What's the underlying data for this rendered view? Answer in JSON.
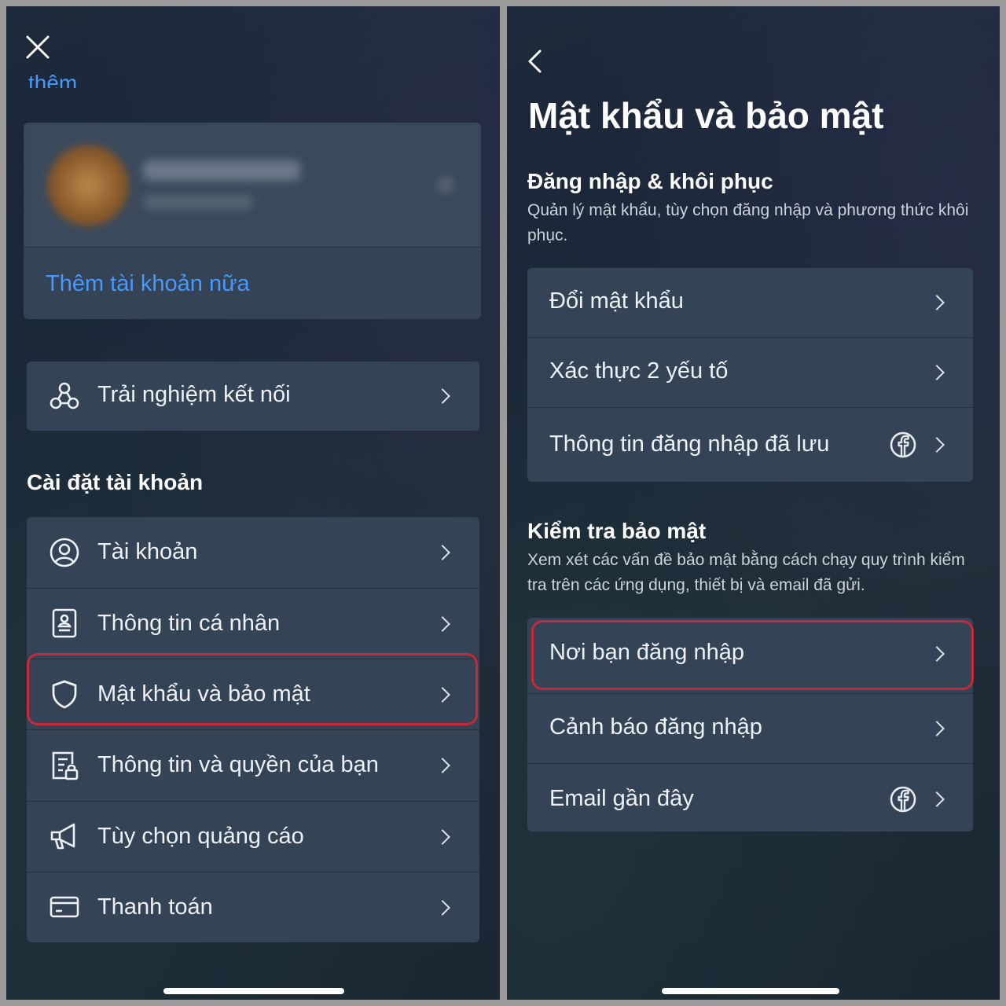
{
  "left": {
    "close_icon": "close-icon",
    "cutoff_text": "thêm",
    "add_account_label": "Thêm tài khoản nữa",
    "connected_experience_label": "Trải nghiệm kết nối",
    "account_settings_heading": "Cài đặt tài khoản",
    "menu": [
      {
        "label": "Tài khoản",
        "icon": "user-circle-icon"
      },
      {
        "label": "Thông tin cá nhân",
        "icon": "id-card-icon"
      },
      {
        "label": "Mật khẩu và bảo mật",
        "icon": "shield-icon"
      },
      {
        "label": "Thông tin và quyền của bạn",
        "icon": "info-lock-icon"
      },
      {
        "label": "Tùy chọn quảng cáo",
        "icon": "megaphone-icon"
      },
      {
        "label": "Thanh toán",
        "icon": "credit-card-icon"
      }
    ]
  },
  "right": {
    "back_icon": "back-icon",
    "page_title": "Mật khẩu và bảo mật",
    "login_section": {
      "title": "Đăng nhập & khôi phục",
      "description": "Quản lý mật khẩu, tùy chọn đăng nhập và phương thức khôi phục.",
      "items": [
        {
          "label": "Đổi mật khẩu"
        },
        {
          "label": "Xác thực 2 yếu tố"
        },
        {
          "label": "Thông tin đăng nhập đã lưu",
          "icon": "facebook-icon"
        }
      ]
    },
    "security_section": {
      "title": "Kiểm tra bảo mật",
      "description": "Xem xét các vấn đề bảo mật bằng cách chạy quy trình kiểm tra trên các ứng dụng, thiết bị và email đã gửi.",
      "items": [
        {
          "label": "Nơi bạn đăng nhập"
        },
        {
          "label": "Cảnh báo đăng nhập"
        },
        {
          "label": "Email gần đây",
          "icon": "facebook-icon"
        }
      ]
    }
  },
  "colors": {
    "background": "#1d2a3b",
    "card": "#344355",
    "link_blue": "#4599ff",
    "highlight_red": "#c8283a"
  }
}
